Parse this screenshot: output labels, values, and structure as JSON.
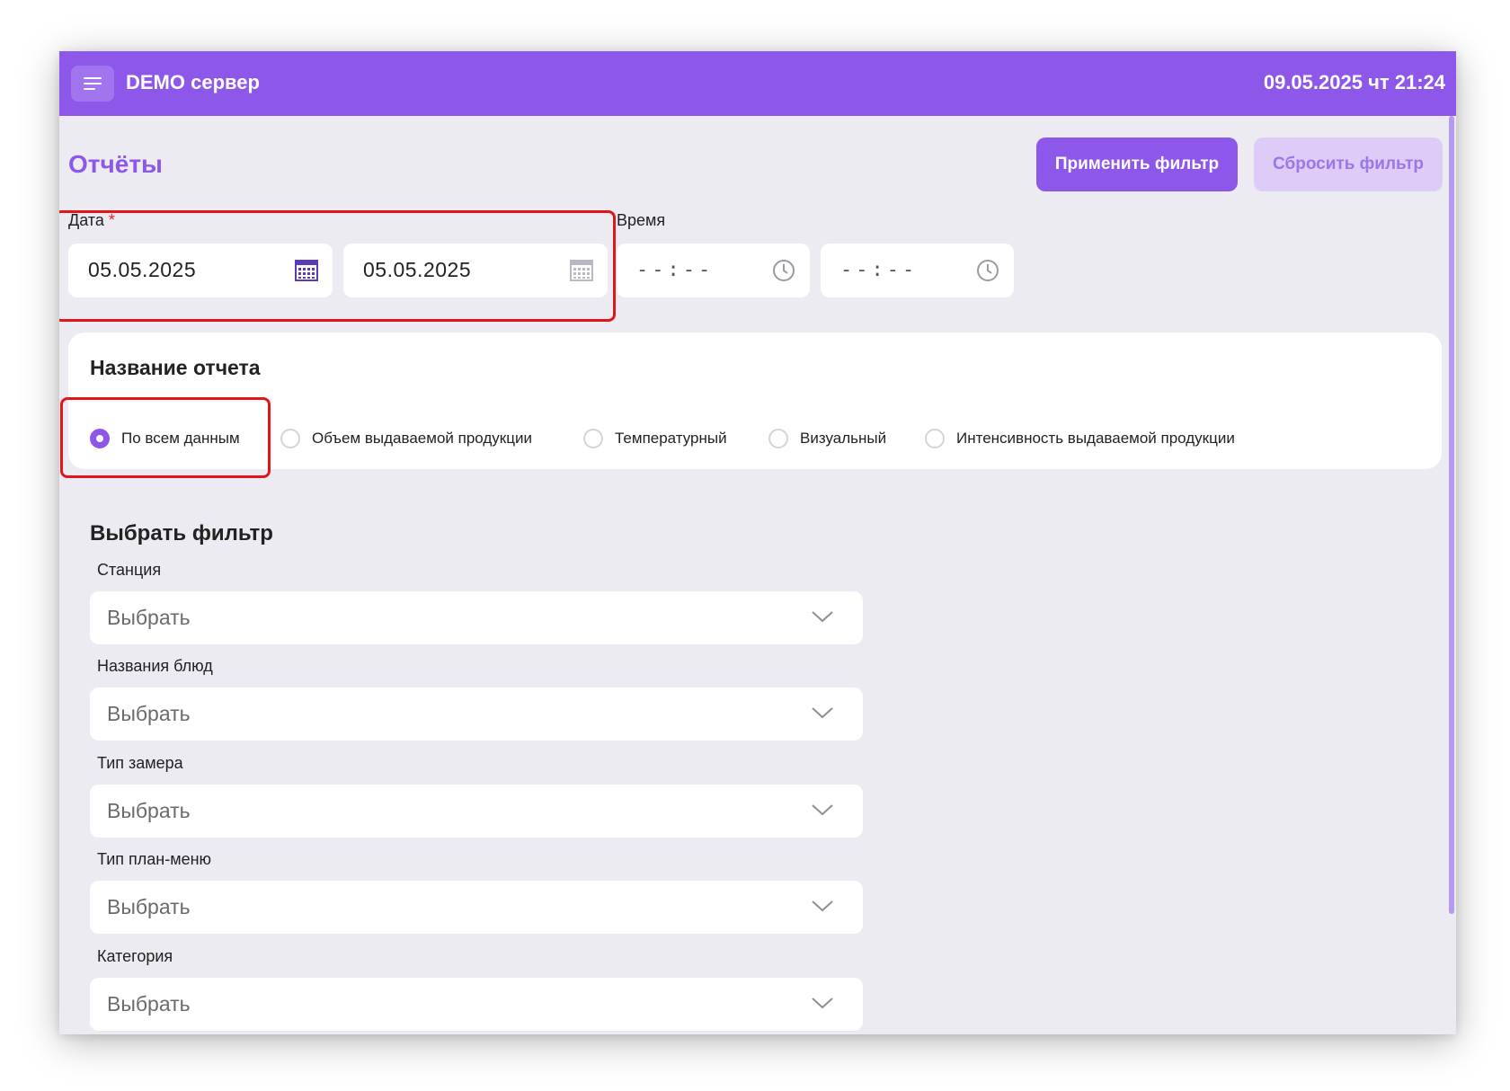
{
  "header": {
    "server_title": "DEMO сервер",
    "datetime": "09.05.2025 чт 21:24"
  },
  "page": {
    "title": "Отчёты",
    "apply_button": "Применить фильтр",
    "reset_button": "Сбросить фильтр"
  },
  "date": {
    "label": "Дата",
    "required_mark": "*",
    "from": "05.05.2025",
    "to": "05.05.2025"
  },
  "time": {
    "label": "Время",
    "from": "--:--",
    "to": "--:--"
  },
  "report": {
    "title": "Название отчета",
    "options": [
      {
        "label": "По всем данным",
        "checked": true
      },
      {
        "label": "Объем выдаваемой продукции",
        "checked": false
      },
      {
        "label": "Температурный",
        "checked": false
      },
      {
        "label": "Визуальный",
        "checked": false
      },
      {
        "label": "Интенсивность выдаваемой продукции",
        "checked": false
      }
    ]
  },
  "filters": {
    "title": "Выбрать фильтр",
    "items": [
      {
        "label": "Станция",
        "placeholder": "Выбрать"
      },
      {
        "label": "Названия блюд",
        "placeholder": "Выбрать"
      },
      {
        "label": "Тип замера",
        "placeholder": "Выбрать"
      },
      {
        "label": "Тип план-меню",
        "placeholder": "Выбрать"
      },
      {
        "label": "Категория",
        "placeholder": "Выбрать"
      }
    ]
  },
  "colors": {
    "accent": "#8d57ea",
    "highlight": "#e4141c"
  }
}
